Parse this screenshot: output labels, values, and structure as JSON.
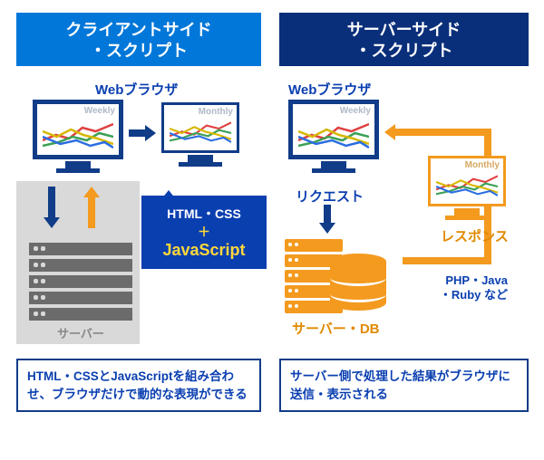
{
  "left": {
    "header_line1": "クライアントサイド",
    "header_line2": "・スクリプト",
    "browser_label": "Webブラウザ",
    "monitor_tag_weekly": "Weekly",
    "monitor_tag_monthly": "Monthly",
    "server_label": "サーバー",
    "bubble_line1": "HTML・CSS",
    "bubble_plus": "＋",
    "bubble_js": "JavaScript",
    "caption": "HTML・CSSとJavaScriptを組み合わせ、ブラウザだけで動的な表現ができる"
  },
  "right": {
    "header_line1": "サーバーサイド",
    "header_line2": "・スクリプト",
    "browser_label": "Webブラウザ",
    "monitor_tag_weekly": "Weekly",
    "monitor_tag_monthly": "Monthly",
    "request_label": "リクエスト",
    "response_label": "レスポンス",
    "server_db_label": "サーバー・DB",
    "tech_line1": "PHP・Java",
    "tech_line2": "・Ruby など",
    "caption": "サーバー側で処理した結果がブラウザに送信・表示される"
  },
  "colors": {
    "blue": "#0a3fb0",
    "navy": "#0a2f7a",
    "accent_blue": "#0077d9",
    "orange": "#f39a1f",
    "gray": "#6b6b6b"
  }
}
